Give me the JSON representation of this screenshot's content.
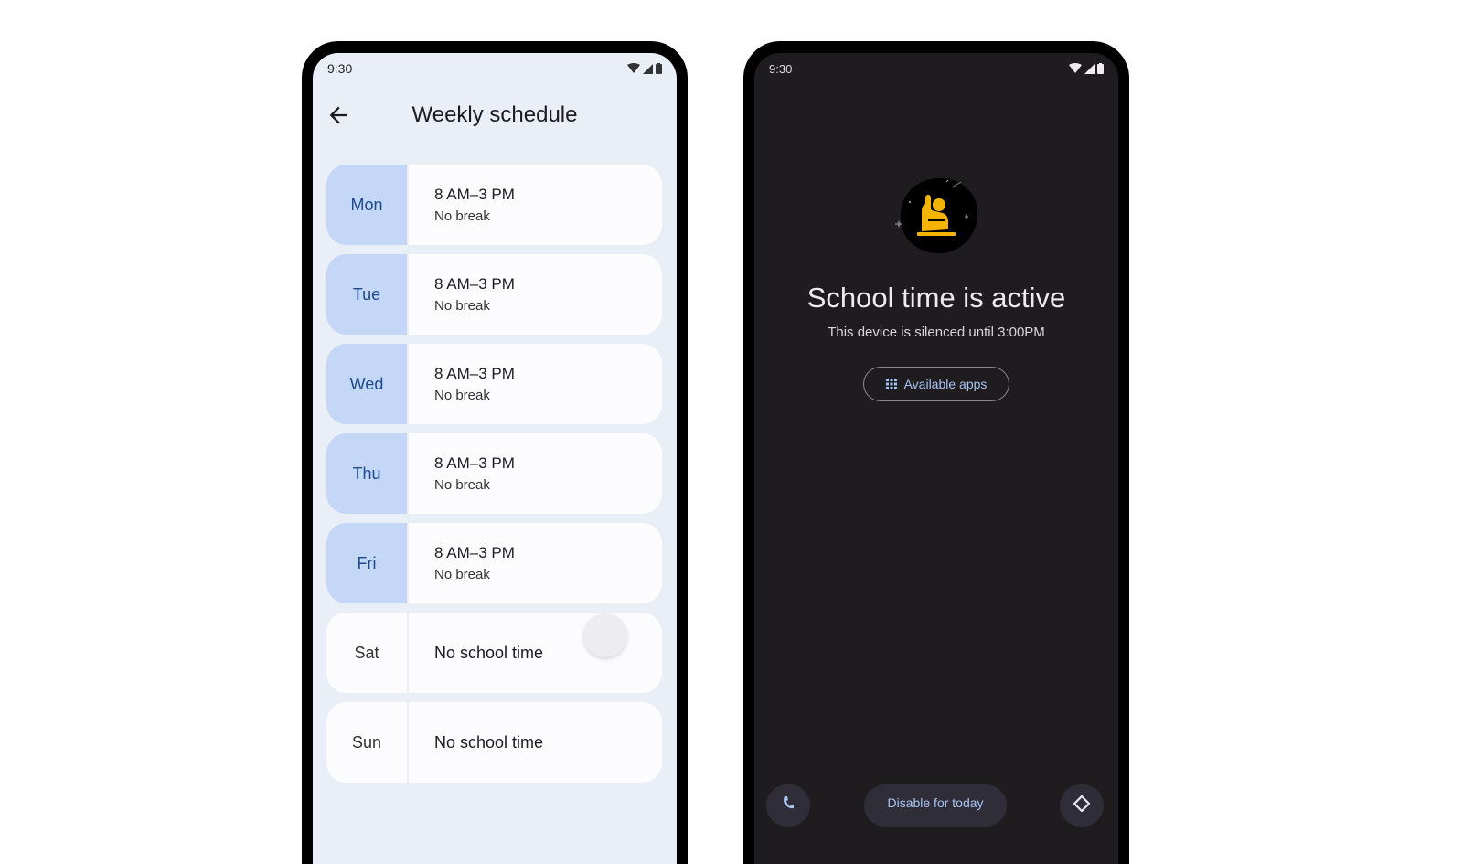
{
  "left_phone": {
    "status_bar": {
      "time": "9:30",
      "icons": [
        "wifi-icon",
        "signal-icon",
        "battery-icon"
      ]
    },
    "app_bar": {
      "back_icon": "arrow-back-icon",
      "title": "Weekly schedule"
    },
    "days": [
      {
        "day": "Mon",
        "active": true,
        "time": "8 AM–3 PM",
        "break": "No break"
      },
      {
        "day": "Tue",
        "active": true,
        "time": "8 AM–3 PM",
        "break": "No break"
      },
      {
        "day": "Wed",
        "active": true,
        "time": "8 AM–3 PM",
        "break": "No break"
      },
      {
        "day": "Thu",
        "active": true,
        "time": "8 AM–3 PM",
        "break": "No break"
      },
      {
        "day": "Fri",
        "active": true,
        "time": "8 AM–3 PM",
        "break": "No break"
      },
      {
        "day": "Sat",
        "active": false,
        "status": "No school time"
      },
      {
        "day": "Sun",
        "active": false,
        "status": "No school time"
      }
    ]
  },
  "right_phone": {
    "status_bar": {
      "time": "9:30",
      "icons": [
        "wifi-icon",
        "signal-icon",
        "battery-icon"
      ]
    },
    "hero_icon": "student-raising-hand-icon",
    "title": "School time is active",
    "subtitle": "This device is silenced until 3:00PM",
    "available_apps_button": {
      "icon": "apps-grid-icon",
      "label": "Available apps"
    },
    "bottom_actions": {
      "phone_icon": "phone-icon",
      "disable_label": "Disable for today",
      "directions_icon": "directions-icon"
    }
  },
  "colors": {
    "light_bg": "#eaeef7",
    "active_day_bg": "#c4d7f7",
    "active_day_text": "#1d4a8c",
    "dark_bg": "#1e1c1f",
    "accent_blue": "#a8c4f5",
    "hero_yellow": "#f5b400"
  }
}
